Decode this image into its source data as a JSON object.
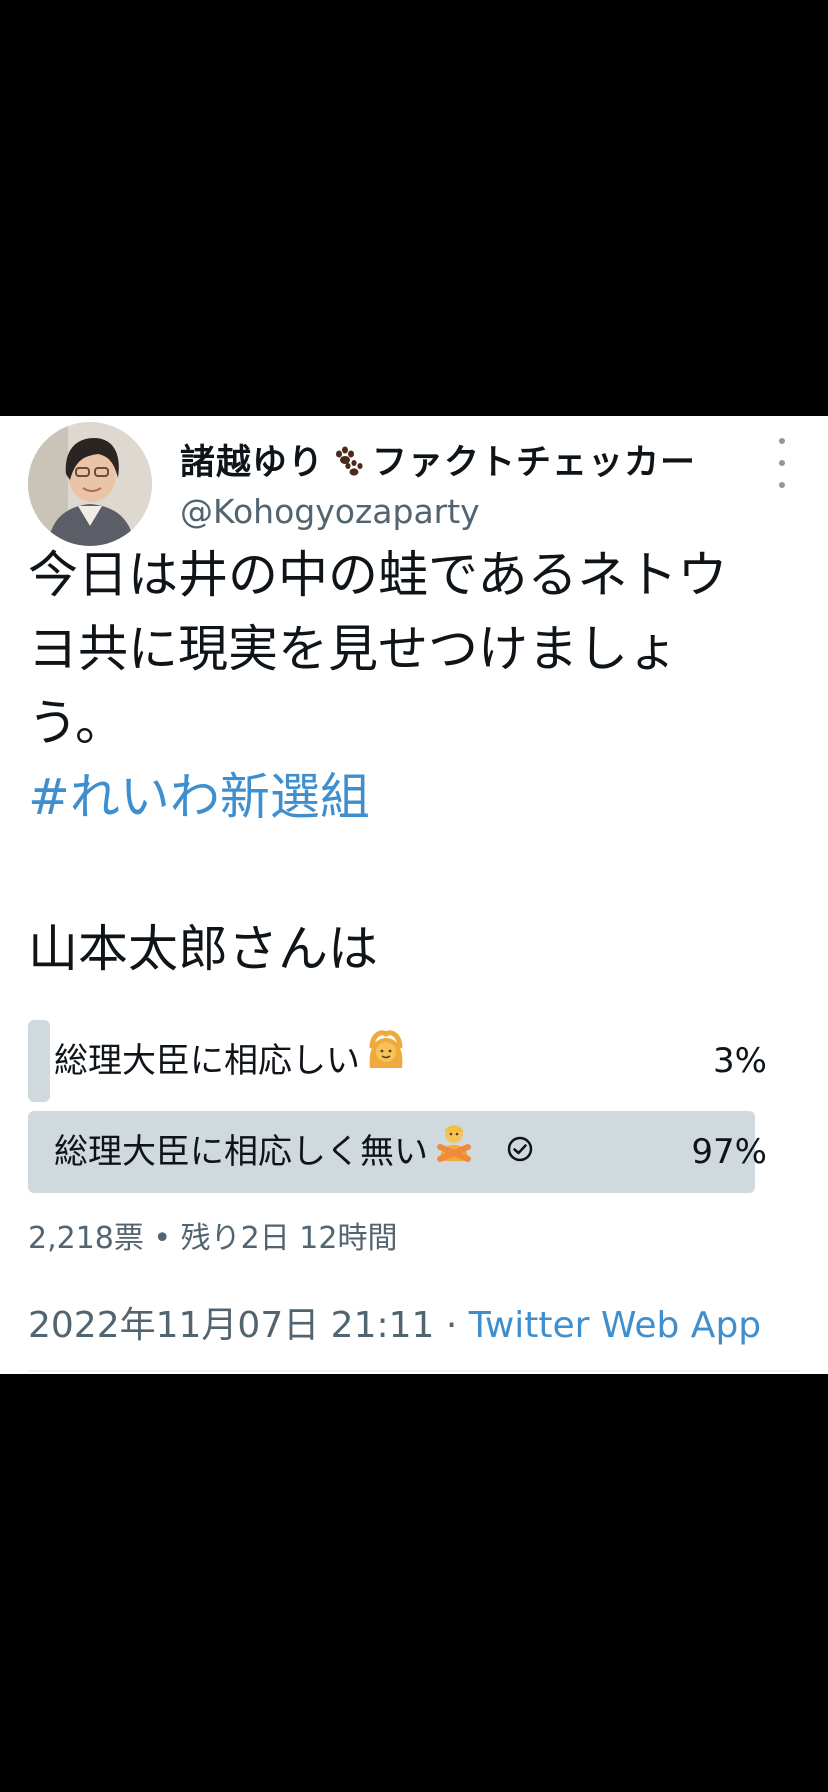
{
  "user": {
    "display_name_before": "諸越ゆり",
    "display_name_after": "ファクトチェッカー",
    "name_icon": "paw-prints-icon",
    "handle": "@Kohogyozaparty"
  },
  "tweet": {
    "lines": [
      "今日は井の中の蛙であるネトウ",
      "ヨ共に現実を見せつけましょ",
      "う。"
    ],
    "hashtag": "#れいわ新選組"
  },
  "poll": {
    "question": "山本太郎さんは",
    "options": [
      {
        "label": "総理大臣に相応しい",
        "emoji": "person-gesturing-ok-icon",
        "percent": "3%",
        "fraction": 0.03,
        "winner": false
      },
      {
        "label": "総理大臣に相応しく無い",
        "emoji": "person-gesturing-no-icon",
        "percent": "97%",
        "fraction": 0.97,
        "winner": true
      }
    ],
    "meta": "2,218票 • 残り2日 12時間"
  },
  "timestamp": "2022年11月07日 21:11",
  "separator": " · ",
  "source": "Twitter Web App",
  "colors": {
    "link": "#3f8fce",
    "poll_bar": "#cfd9de",
    "secondary_text": "#536471",
    "primary_text": "#0f1419",
    "background": "#ffffff",
    "letterbox": "#000000"
  }
}
